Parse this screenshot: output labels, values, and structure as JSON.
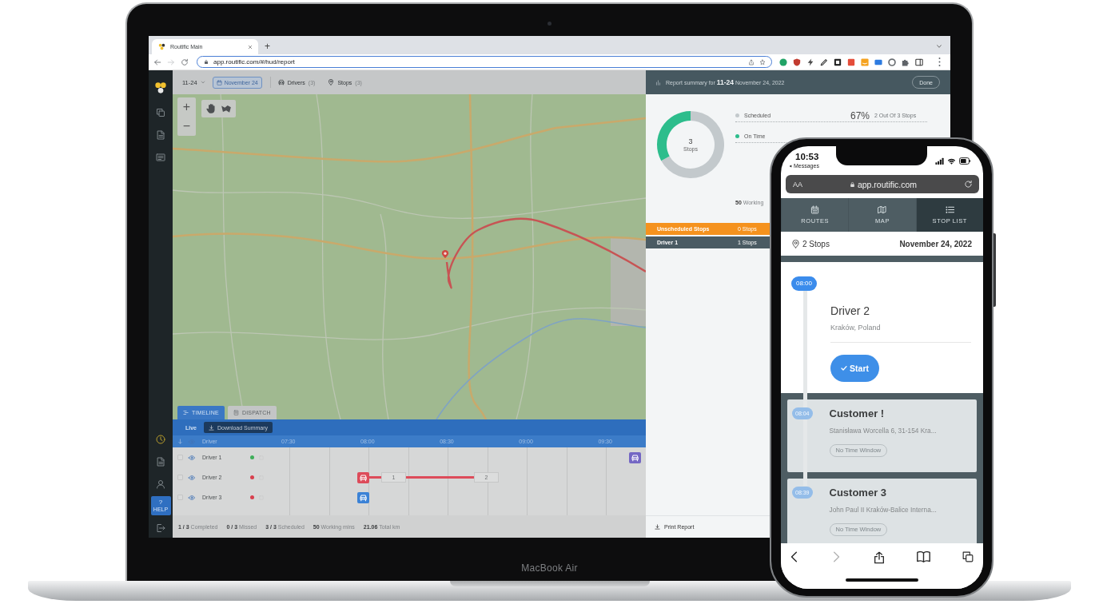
{
  "laptop": {
    "label": "MacBook Air"
  },
  "browser": {
    "tabs": [
      {
        "title": "Routific Main",
        "selected": true
      }
    ],
    "new_tab": "+",
    "forward_disabled": true,
    "url": "app.routific.com/#/hud/report"
  },
  "app": {
    "sidebar": {
      "help": {
        "mark": "?",
        "label": "HELP"
      }
    },
    "toolbar": {
      "route": "11-24",
      "date": "November 24",
      "filters": [
        {
          "label": "Drivers",
          "count": "(3)"
        },
        {
          "label": "Stops",
          "count": "(3)"
        }
      ]
    },
    "map": {
      "zoom_in": "+",
      "zoom_out": "−",
      "tabs": [
        {
          "label": "TIMELINE",
          "selected": true
        },
        {
          "label": "DISPATCH",
          "selected": false
        }
      ]
    },
    "timeline": {
      "live": "Live",
      "download": "Download Summary",
      "columns": {
        "driver": "Driver",
        "times": [
          "07:30",
          "08:00",
          "08:30",
          "09:00",
          "09:30"
        ]
      },
      "rows": [
        {
          "name": "Driver 1",
          "checked": false,
          "color": "#3fae5a",
          "vehicle": {
            "color": "#7467c4"
          },
          "stops": []
        },
        {
          "name": "Driver 2",
          "checked": false,
          "color": "#d8404e",
          "vehicle": {
            "color": "#dd4b5a"
          },
          "stops": [
            "1",
            "2"
          ]
        },
        {
          "name": "Driver 3",
          "checked": false,
          "color": "#d8404e",
          "vehicle": {
            "color": "#3b82d6"
          },
          "stops": []
        }
      ]
    },
    "stats": [
      "**1 / 3** Completed",
      "**0 / 3** Missed",
      "**3 / 3** Scheduled",
      "**50** Working mins",
      "**21.06** Total km"
    ]
  },
  "report": {
    "title": "Report summary for **11-24** November 24, 2022",
    "done": "Done",
    "chart_data": {
      "type": "donut",
      "categories": [
        "Scheduled",
        "On Time"
      ],
      "values": [
        67,
        33
      ]
    },
    "center": {
      "value": "3",
      "label": "Stops"
    },
    "legend": [
      {
        "color": "#c3c9cc",
        "percent": "67%",
        "detail": "2 Out Of 3 Stops"
      },
      {
        "color": "#2dbd8c"
      }
    ],
    "working": "**50** Working",
    "rows": [
      {
        "kind": "unscheduled",
        "label": "Unscheduled Stops",
        "count": "0 Stops"
      },
      {
        "kind": "driver",
        "label": "Driver 1",
        "count": "1 Stops"
      }
    ],
    "print": "Print Report"
  },
  "phone": {
    "time": "10:53",
    "back": "Messages",
    "text_size": "AA",
    "url": "app.routific.com",
    "tabs": [
      {
        "label": "ROUTES",
        "selected": false
      },
      {
        "label": "MAP",
        "selected": false
      },
      {
        "label": "STOP LIST",
        "selected": true
      }
    ],
    "stop_count": "2 Stops",
    "date": "November 24, 2022",
    "stops": [
      {
        "kind": "start",
        "time": "08:00",
        "title": "Driver 2",
        "address": "Kraków, Poland",
        "action": "Start"
      },
      {
        "kind": "customer",
        "time": "08:04",
        "title": "Customer !",
        "address": "Stanisława Worcella 6, 31-154 Kra...",
        "window": "No Time Window"
      },
      {
        "kind": "customer",
        "time": "08:39",
        "title": "Customer 3",
        "address": "John Paul II Kraków-Balice Interna...",
        "window": "No Time Window"
      }
    ],
    "forward_disabled": true
  }
}
